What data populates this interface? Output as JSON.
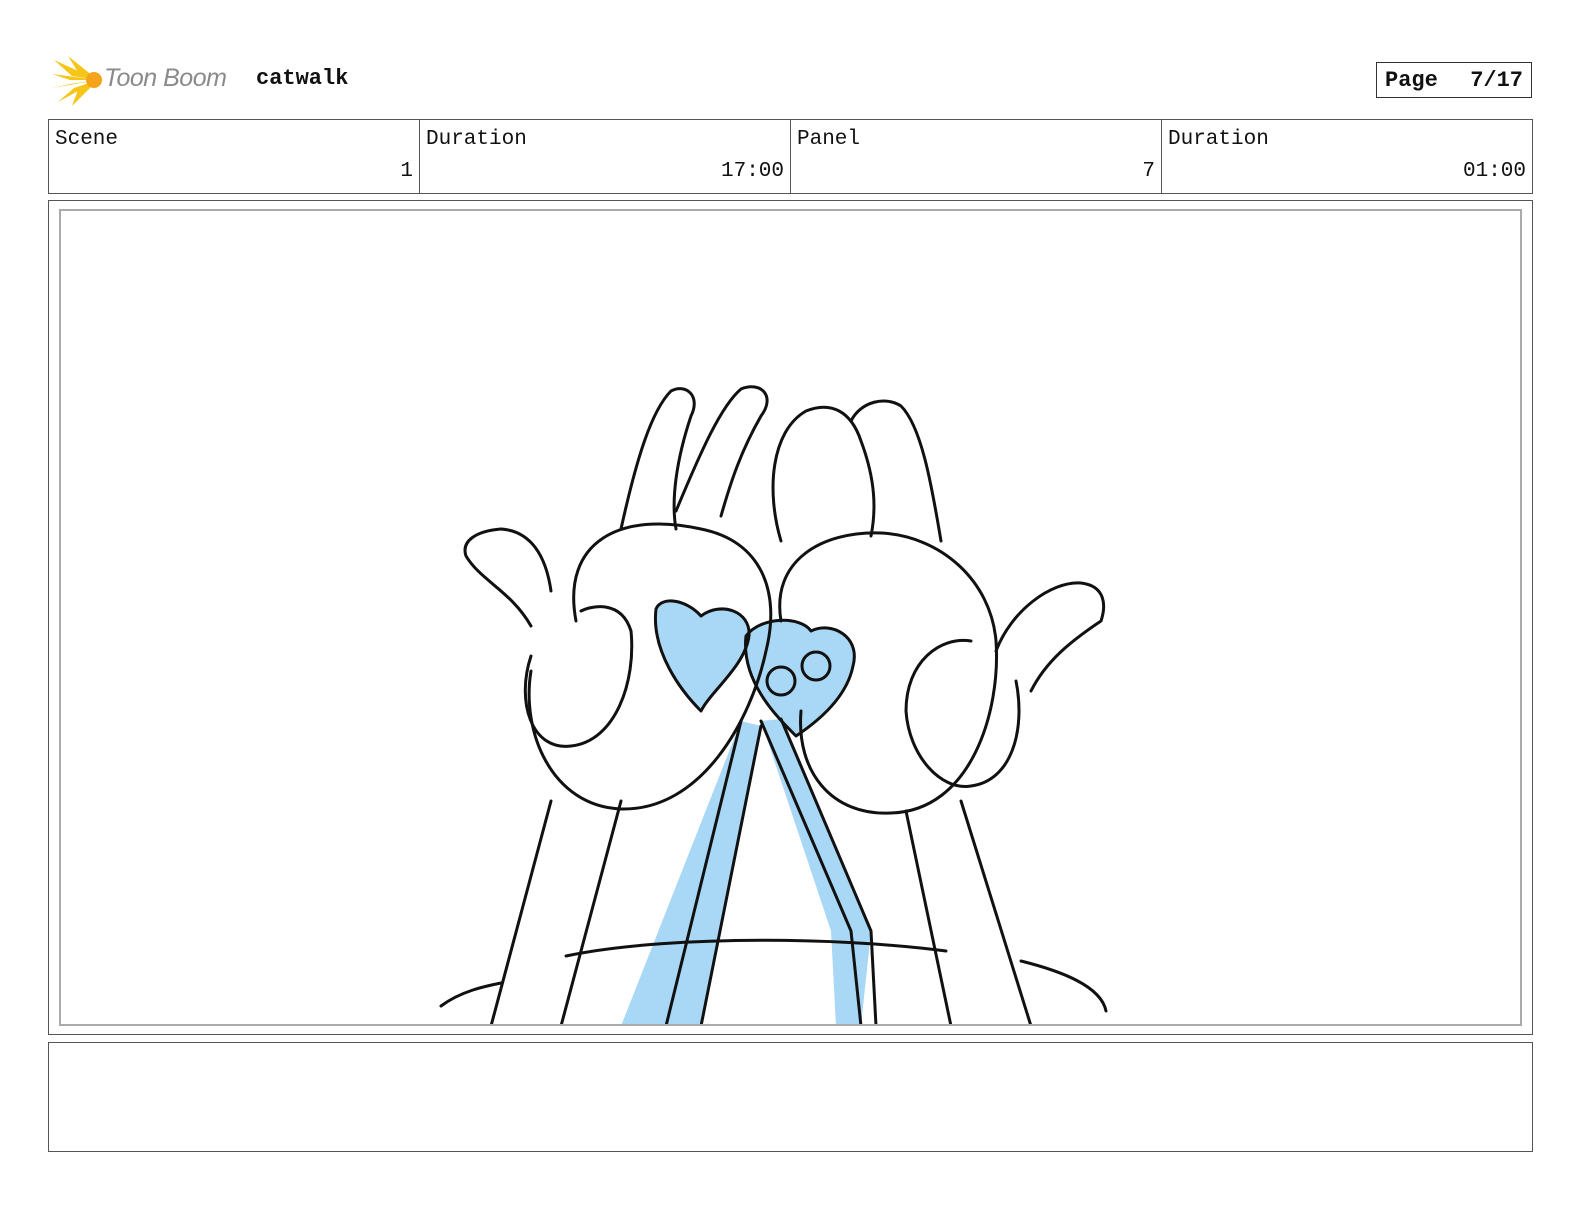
{
  "header": {
    "brand": "Toon Boom",
    "project_title": "catwalk",
    "page_label": "Page",
    "page_value": "7/17"
  },
  "info": {
    "scene_label": "Scene",
    "scene_value": "1",
    "scene_duration_label": "Duration",
    "scene_duration_value": "17:00",
    "panel_label": "Panel",
    "panel_value": "7",
    "panel_duration_label": "Duration",
    "panel_duration_value": "01:00"
  },
  "notes": {
    "text": ""
  },
  "colors": {
    "sketch_line": "#111111",
    "accent_blue": "#a8d8f5",
    "logo_yellow": "#f5c518"
  },
  "icons": {
    "logo": "toon-boom-burst-icon"
  }
}
